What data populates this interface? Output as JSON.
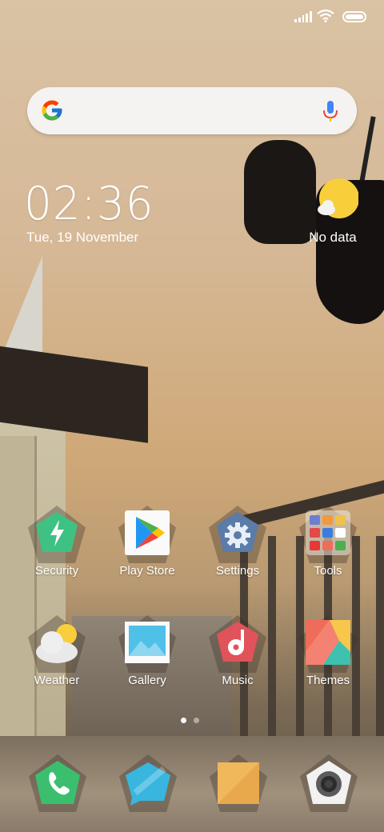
{
  "status_bar": {
    "signal_icon": "signal-bars-icon",
    "wifi_icon": "wifi-icon",
    "battery_icon": "battery-icon"
  },
  "search": {
    "logo_icon": "google-g-icon",
    "mic_icon": "microphone-icon"
  },
  "clock": {
    "time": "02:36",
    "date": "Tue, 19 November"
  },
  "weather_widget": {
    "icon": "sun-cloud-icon",
    "text": "No data"
  },
  "apps": [
    {
      "label": "Security",
      "icon": "shield-bolt-icon"
    },
    {
      "label": "Play Store",
      "icon": "play-store-icon"
    },
    {
      "label": "Settings",
      "icon": "gear-icon"
    },
    {
      "label": "Tools",
      "icon": "folder-icon"
    },
    {
      "label": "Weather",
      "icon": "weather-cloud-icon"
    },
    {
      "label": "Gallery",
      "icon": "gallery-icon"
    },
    {
      "label": "Music",
      "icon": "music-note-icon"
    },
    {
      "label": "Themes",
      "icon": "themes-icon"
    }
  ],
  "page_indicator": {
    "pages": 2,
    "active": 1
  },
  "dock": [
    {
      "icon": "phone-icon"
    },
    {
      "icon": "messages-icon"
    },
    {
      "icon": "notes-icon"
    },
    {
      "icon": "camera-icon"
    }
  ],
  "colors": {
    "security": "#3fc184",
    "settings": "#5b7ba8",
    "music": "#e0535a",
    "phone": "#3bbf6f",
    "messages": "#38b6e0",
    "notes": "#f0b75b",
    "weather_sun": "#f8cf3b"
  }
}
